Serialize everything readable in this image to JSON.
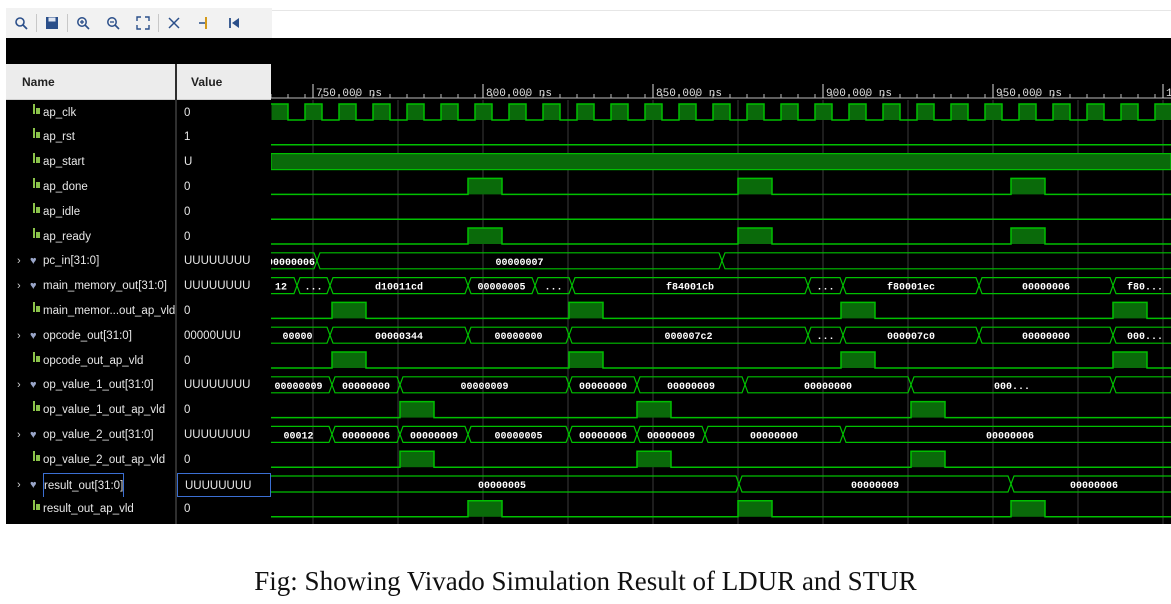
{
  "toolbar": {
    "buttons": [
      {
        "name": "search-icon",
        "glyph": "🔍"
      },
      {
        "name": "save-icon",
        "glyph": "💾"
      },
      {
        "name": "zoom-in-icon",
        "glyph": "⊕"
      },
      {
        "name": "zoom-out-icon",
        "glyph": "⊖"
      },
      {
        "name": "zoom-fit-icon",
        "glyph": "⛶"
      },
      {
        "name": "cursor-icon",
        "glyph": "✕"
      },
      {
        "name": "marker-icon",
        "glyph": "↦"
      },
      {
        "name": "go-to-start-icon",
        "glyph": "⏮"
      }
    ]
  },
  "columns": {
    "name": "Name",
    "value": "Value"
  },
  "time_labels": [
    "750.000 ns",
    "800.000 ns",
    "850.000 ns",
    "900.000 ns",
    "950.000 ns",
    "1"
  ],
  "signals": [
    {
      "name": "ap_clk",
      "value": "0",
      "bus": false
    },
    {
      "name": "ap_rst",
      "value": "1",
      "bus": false
    },
    {
      "name": "ap_start",
      "value": "U",
      "bus": false
    },
    {
      "name": "ap_done",
      "value": "0",
      "bus": false
    },
    {
      "name": "ap_idle",
      "value": "0",
      "bus": false
    },
    {
      "name": "ap_ready",
      "value": "0",
      "bus": false
    },
    {
      "name": "pc_in[31:0]",
      "value": "UUUUUUUU",
      "bus": true
    },
    {
      "name": "main_memory_out[31:0]",
      "value": "UUUUUUUU",
      "bus": true
    },
    {
      "name": "main_memor...out_ap_vld",
      "value": "0",
      "bus": false
    },
    {
      "name": "opcode_out[31:0]",
      "value": "00000UUU",
      "bus": true
    },
    {
      "name": "opcode_out_ap_vld",
      "value": "0",
      "bus": false
    },
    {
      "name": "op_value_1_out[31:0]",
      "value": "UUUUUUUU",
      "bus": true
    },
    {
      "name": "op_value_1_out_ap_vld",
      "value": "0",
      "bus": false
    },
    {
      "name": "op_value_2_out[31:0]",
      "value": "UUUUUUUU",
      "bus": true
    },
    {
      "name": "op_value_2_out_ap_vld",
      "value": "0",
      "bus": false
    },
    {
      "name": "result_out[31:0]",
      "value": "UUUUUUUU",
      "bus": true
    },
    {
      "name": "result_out_ap_vld",
      "value": "0",
      "bus": false
    }
  ],
  "bus_values": {
    "pc_in": [
      "00000006",
      "00000007"
    ],
    "main_memory_out": [
      "12",
      "...",
      "d10011cd",
      "00000005",
      "...",
      "f84001cb",
      "...",
      "f80001ec",
      "00000006",
      "f80..."
    ],
    "opcode_out": [
      "00000",
      "00000344",
      "00000000",
      "000007c2",
      "...",
      "000007c0",
      "00000000",
      "000..."
    ],
    "op_value_1_out": [
      "00000009",
      "00000000",
      "00000009",
      "00000000",
      "00000009",
      "00000000",
      "000..."
    ],
    "op_value_2_out": [
      "00012",
      "00000006",
      "00000009",
      "00000005",
      "00000006",
      "00000009",
      "00000000",
      "00000006"
    ],
    "result_out": [
      "00000005",
      "00000009",
      "00000006"
    ]
  },
  "caption": "Fig: Showing Vivado Simulation Result of LDUR and STUR",
  "colors": {
    "wave": "#00c000",
    "fill": "#0a6a0a",
    "background": "#000000",
    "grid": "#3a3a3a"
  }
}
